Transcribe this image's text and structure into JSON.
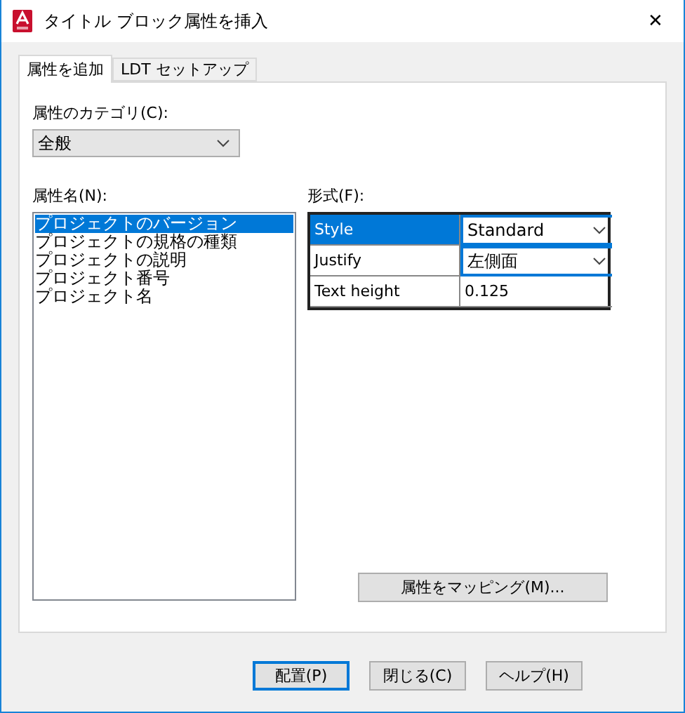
{
  "window": {
    "title": "タイトル ブロック属性を挿入",
    "close": "✕"
  },
  "tabs": [
    {
      "label": "属性を追加",
      "selected": true
    },
    {
      "label": "LDT セットアップ",
      "selected": false
    }
  ],
  "category": {
    "label": "属性のカテゴリ(C):",
    "value": "全般"
  },
  "names": {
    "label": "属性名(N):",
    "items": [
      {
        "text": "プロジェクトのバージョン",
        "selected": true
      },
      {
        "text": "プロジェクトの規格の種類",
        "selected": false
      },
      {
        "text": "プロジェクトの説明",
        "selected": false
      },
      {
        "text": "プロジェクト番号",
        "selected": false
      },
      {
        "text": "プロジェクト名",
        "selected": false
      }
    ]
  },
  "format": {
    "label": "形式(F):",
    "rows": [
      {
        "name": "Style",
        "value": "Standard",
        "kind": "dropdown",
        "selected": true
      },
      {
        "name": "Justify",
        "value": "左側面",
        "kind": "dropdown",
        "selected": false
      },
      {
        "name": "Text height",
        "value": "0.125",
        "kind": "text",
        "selected": false
      }
    ]
  },
  "map_button": "属性をマッピング(M)...",
  "buttons": [
    {
      "label": "配置(P)",
      "default": true
    },
    {
      "label": "閉じる(C)",
      "default": false
    },
    {
      "label": "ヘルプ(H)",
      "default": false
    }
  ]
}
